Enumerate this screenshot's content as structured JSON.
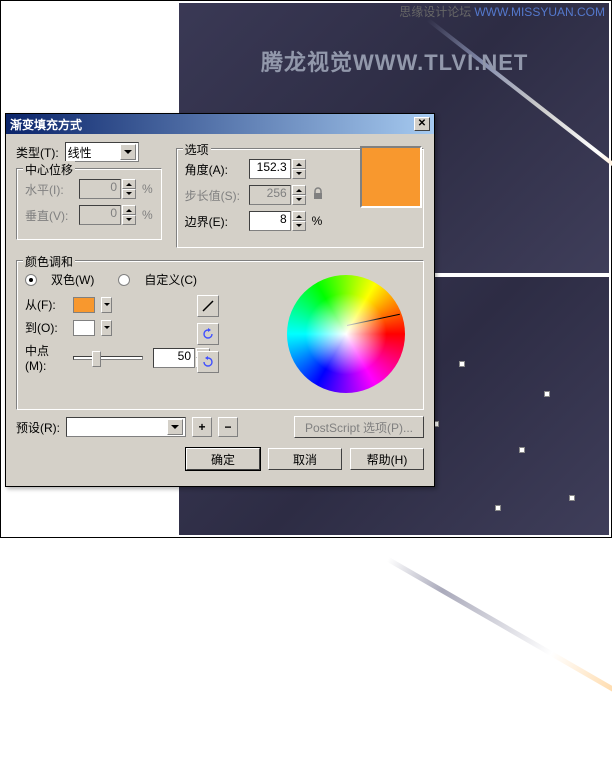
{
  "watermark": {
    "source": "思缘设计论坛",
    "url": "WWW.MISSYUAN.COM",
    "center": "腾龙视觉WWW.TLVI.NET"
  },
  "dialog": {
    "title": "渐变填充方式",
    "type_label": "类型(T):",
    "type_value": "线性",
    "center_offset_title": "中心位移",
    "horiz_label": "水平(I):",
    "vert_label": "垂直(V):",
    "horiz_value": "0",
    "vert_value": "0",
    "pct": "%",
    "options_title": "选项",
    "angle_label": "角度(A):",
    "angle_value": "152.3",
    "step_label": "步长值(S):",
    "step_value": "256",
    "edge_label": "边界(E):",
    "edge_value": "8",
    "blend_title": "颜色调和",
    "two_color_label": "双色(W)",
    "custom_label": "自定义(C)",
    "from_label": "从(F):",
    "to_label": "到(O):",
    "mid_label": "中点(M):",
    "mid_value": "50",
    "preset_label": "预设(R):",
    "ps_btn": "PostScript 选项(P)...",
    "ok": "确定",
    "cancel": "取消",
    "help": "帮助(H)",
    "swatch_color": "#f8982e",
    "from_color": "#f8982e",
    "to_color": "#ffffff"
  }
}
